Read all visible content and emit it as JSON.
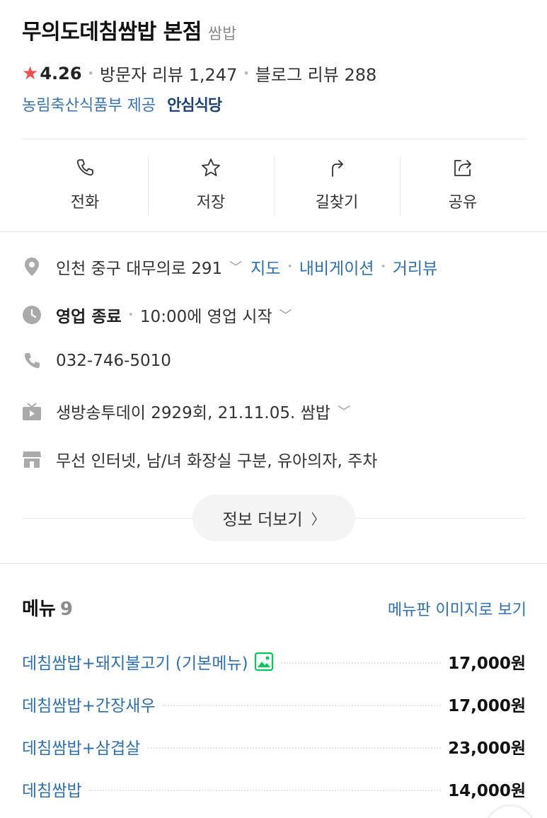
{
  "place": {
    "name": "무의도데침쌈밥 본점",
    "category": "쌈밥",
    "rating": "4.26",
    "visitor_reviews": "방문자 리뷰 1,247",
    "blog_reviews": "블로그 리뷰 288",
    "provider": "농림축산식품부 제공",
    "safe_badge": "안심식당"
  },
  "actions": [
    {
      "label": "전화",
      "icon": "phone-icon"
    },
    {
      "label": "저장",
      "icon": "star-outline-icon"
    },
    {
      "label": "길찾기",
      "icon": "directions-icon"
    },
    {
      "label": "공유",
      "icon": "share-icon"
    }
  ],
  "info": {
    "address": "인천 중구 대무의로 291",
    "map_link": "지도",
    "navigation_link": "내비게이션",
    "streetview_link": "거리뷰",
    "status": "영업 종료",
    "hours": "10:00에 영업 시작",
    "phone": "032-746-5010",
    "tv": "생방송투데이 2929회, 21.11.05. 쌈밥",
    "amenities": "무선 인터넷, 남/녀 화장실 구분, 유아의자, 주차",
    "more_label": "정보 더보기"
  },
  "menu": {
    "title": "메뉴",
    "count": "9",
    "board_link": "메뉴판 이미지로 보기",
    "items": [
      {
        "name": "데침쌈밥+돼지불고기 (기본메뉴)",
        "price": "17,000원",
        "has_photo": true
      },
      {
        "name": "데침쌈밥+간장새우",
        "price": "17,000원"
      },
      {
        "name": "데침쌈밥+삼겹살",
        "price": "23,000원"
      },
      {
        "name": "데침쌈밥",
        "price": "14,000원"
      }
    ]
  },
  "colors": {
    "link": "#2e6fb0",
    "star": "#f04e4e",
    "safe_badge": "#1c3f7a",
    "photo_icon": "#03c75a"
  }
}
